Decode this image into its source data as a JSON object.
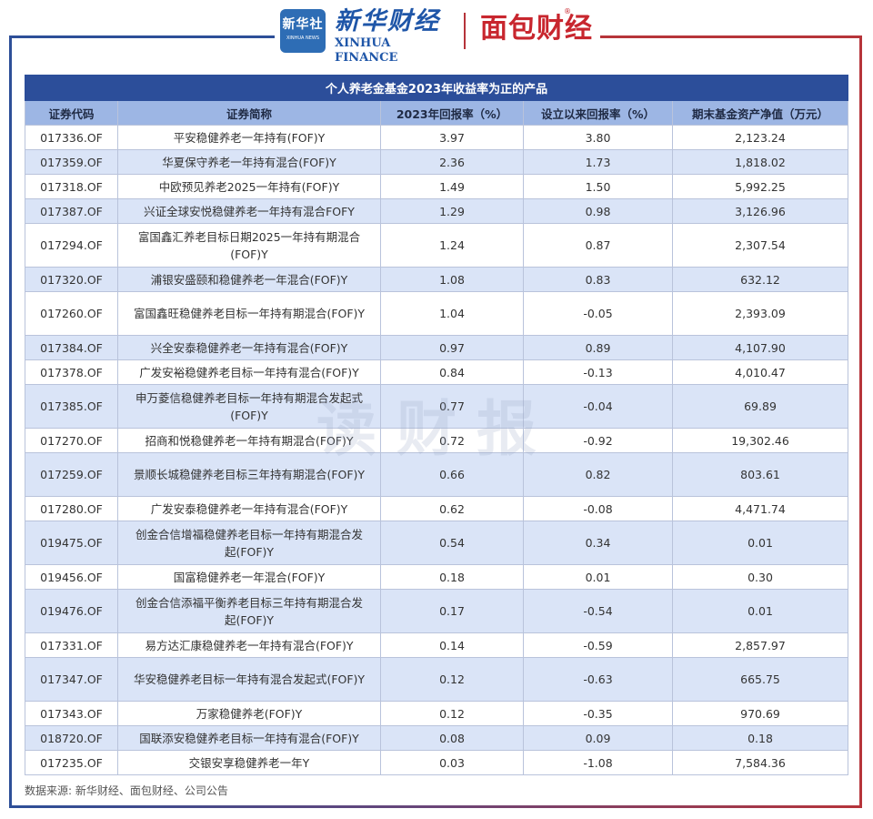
{
  "header": {
    "xinhua_badge_cn": "新华社",
    "xinhua_badge_en": "XINHUA NEWS",
    "xinhua_finance_cn": "新华财经",
    "xinhua_finance_en": "XINHUA FINANCE",
    "mianbao_name": "面包财经",
    "mianbao_mark": "®"
  },
  "table": {
    "title": "个人养老金基金2023年收益率为正的产品",
    "columns": [
      "证券代码",
      "证券简称",
      "2023年回报率（%）",
      "设立以来回报率（%）",
      "期末基金资产净值（万元）"
    ],
    "rows": [
      {
        "code": "017336.OF",
        "name": "平安稳健养老一年持有(FOF)Y",
        "ret2023": "3.97",
        "ret_since": "3.80",
        "nav": "2,123.24"
      },
      {
        "code": "017359.OF",
        "name": "华夏保守养老一年持有混合(FOF)Y",
        "ret2023": "2.36",
        "ret_since": "1.73",
        "nav": "1,818.02"
      },
      {
        "code": "017318.OF",
        "name": "中欧预见养老2025一年持有(FOF)Y",
        "ret2023": "1.49",
        "ret_since": "1.50",
        "nav": "5,992.25"
      },
      {
        "code": "017387.OF",
        "name": "兴证全球安悦稳健养老一年持有混合FOFY",
        "ret2023": "1.29",
        "ret_since": "0.98",
        "nav": "3,126.96"
      },
      {
        "code": "017294.OF",
        "name": "富国鑫汇养老目标日期2025一年持有期混合(FOF)Y",
        "ret2023": "1.24",
        "ret_since": "0.87",
        "nav": "2,307.54"
      },
      {
        "code": "017320.OF",
        "name": "浦银安盛颐和稳健养老一年混合(FOF)Y",
        "ret2023": "1.08",
        "ret_since": "0.83",
        "nav": "632.12"
      },
      {
        "code": "017260.OF",
        "name": "富国鑫旺稳健养老目标一年持有期混合(FOF)Y",
        "ret2023": "1.04",
        "ret_since": "-0.05",
        "nav": "2,393.09"
      },
      {
        "code": "017384.OF",
        "name": "兴全安泰稳健养老一年持有混合(FOF)Y",
        "ret2023": "0.97",
        "ret_since": "0.89",
        "nav": "4,107.90"
      },
      {
        "code": "017378.OF",
        "name": "广发安裕稳健养老目标一年持有混合(FOF)Y",
        "ret2023": "0.84",
        "ret_since": "-0.13",
        "nav": "4,010.47"
      },
      {
        "code": "017385.OF",
        "name": "申万菱信稳健养老目标一年持有期混合发起式(FOF)Y",
        "ret2023": "0.77",
        "ret_since": "-0.04",
        "nav": "69.89"
      },
      {
        "code": "017270.OF",
        "name": "招商和悦稳健养老一年持有期混合(FOF)Y",
        "ret2023": "0.72",
        "ret_since": "-0.92",
        "nav": "19,302.46"
      },
      {
        "code": "017259.OF",
        "name": "景顺长城稳健养老目标三年持有期混合(FOF)Y",
        "ret2023": "0.66",
        "ret_since": "0.82",
        "nav": "803.61"
      },
      {
        "code": "017280.OF",
        "name": "广发安泰稳健养老一年持有混合(FOF)Y",
        "ret2023": "0.62",
        "ret_since": "-0.08",
        "nav": "4,471.74"
      },
      {
        "code": "019475.OF",
        "name": "创金合信增福稳健养老目标一年持有期混合发起(FOF)Y",
        "ret2023": "0.54",
        "ret_since": "0.34",
        "nav": "0.01"
      },
      {
        "code": "019456.OF",
        "name": "国富稳健养老一年混合(FOF)Y",
        "ret2023": "0.18",
        "ret_since": "0.01",
        "nav": "0.30"
      },
      {
        "code": "019476.OF",
        "name": "创金合信添福平衡养老目标三年持有期混合发起(FOF)Y",
        "ret2023": "0.17",
        "ret_since": "-0.54",
        "nav": "0.01"
      },
      {
        "code": "017331.OF",
        "name": "易方达汇康稳健养老一年持有混合(FOF)Y",
        "ret2023": "0.14",
        "ret_since": "-0.59",
        "nav": "2,857.97"
      },
      {
        "code": "017347.OF",
        "name": "华安稳健养老目标一年持有混合发起式(FOF)Y",
        "ret2023": "0.12",
        "ret_since": "-0.63",
        "nav": "665.75"
      },
      {
        "code": "017343.OF",
        "name": "万家稳健养老(FOF)Y",
        "ret2023": "0.12",
        "ret_since": "-0.35",
        "nav": "970.69"
      },
      {
        "code": "018720.OF",
        "name": "国联添安稳健养老目标一年持有混合(FOF)Y",
        "ret2023": "0.08",
        "ret_since": "0.09",
        "nav": "0.18"
      },
      {
        "code": "017235.OF",
        "name": "交银安享稳健养老一年Y",
        "ret2023": "0.03",
        "ret_since": "-1.08",
        "nav": "7,584.36"
      }
    ]
  },
  "watermark": "读财报",
  "source": "数据来源: 新华财经、面包财经、公司公告"
}
